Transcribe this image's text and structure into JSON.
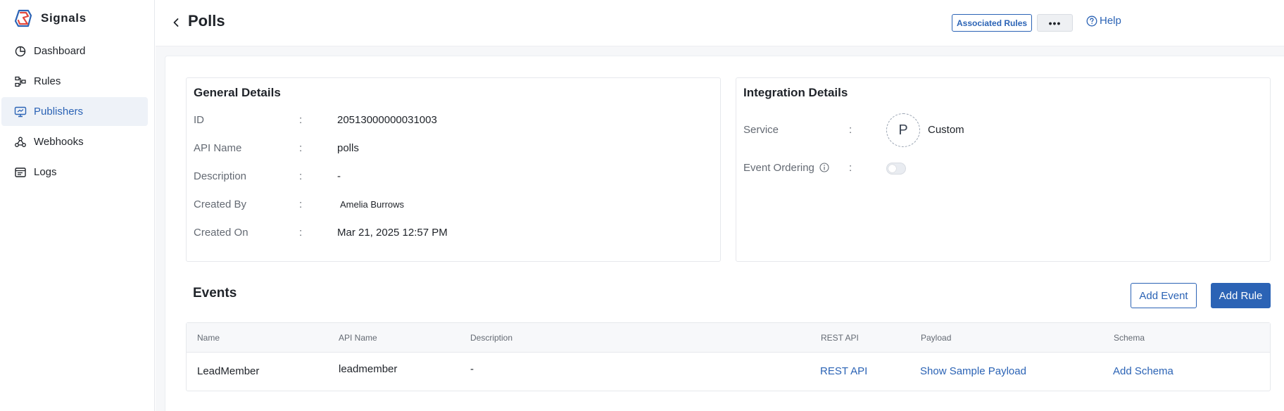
{
  "app": {
    "name": "Signals"
  },
  "sidebar": {
    "items": [
      {
        "label": "Dashboard",
        "icon": "dashboard-icon"
      },
      {
        "label": "Rules",
        "icon": "rules-icon"
      },
      {
        "label": "Publishers",
        "icon": "publishers-icon",
        "active": true
      },
      {
        "label": "Webhooks",
        "icon": "webhooks-icon"
      },
      {
        "label": "Logs",
        "icon": "logs-icon"
      }
    ]
  },
  "header": {
    "title": "Polls",
    "associated_rules_label": "Associated Rules",
    "more_label": "•••",
    "help_label": "Help"
  },
  "general_details": {
    "title": "General Details",
    "separator": ":",
    "fields": [
      {
        "label": "ID",
        "value": "20513000000031003"
      },
      {
        "label": "API Name",
        "value": "polls"
      },
      {
        "label": "Description",
        "value": "-"
      },
      {
        "label": "Created By",
        "value": "Amelia Burrows"
      },
      {
        "label": "Created On",
        "value": "Mar 21, 2025 12:57 PM"
      }
    ]
  },
  "integration_details": {
    "title": "Integration Details",
    "service_label": "Service",
    "service_initial": "P",
    "service_value": "Custom",
    "event_ordering_label": "Event Ordering",
    "event_ordering_enabled": false
  },
  "events": {
    "title": "Events",
    "add_event_label": "Add Event",
    "add_rule_label": "Add Rule",
    "columns": [
      "Name",
      "API Name",
      "Description",
      "REST API",
      "Payload",
      "Schema"
    ],
    "rows": [
      {
        "name": "LeadMember",
        "api_name": "leadmember",
        "description": "-",
        "rest_api": "REST API",
        "payload": "Show Sample Payload",
        "schema": "Add Schema"
      }
    ]
  },
  "colors": {
    "accent": "#2b63b5",
    "logo_red": "#e2483d",
    "logo_blue": "#2b63b5"
  }
}
